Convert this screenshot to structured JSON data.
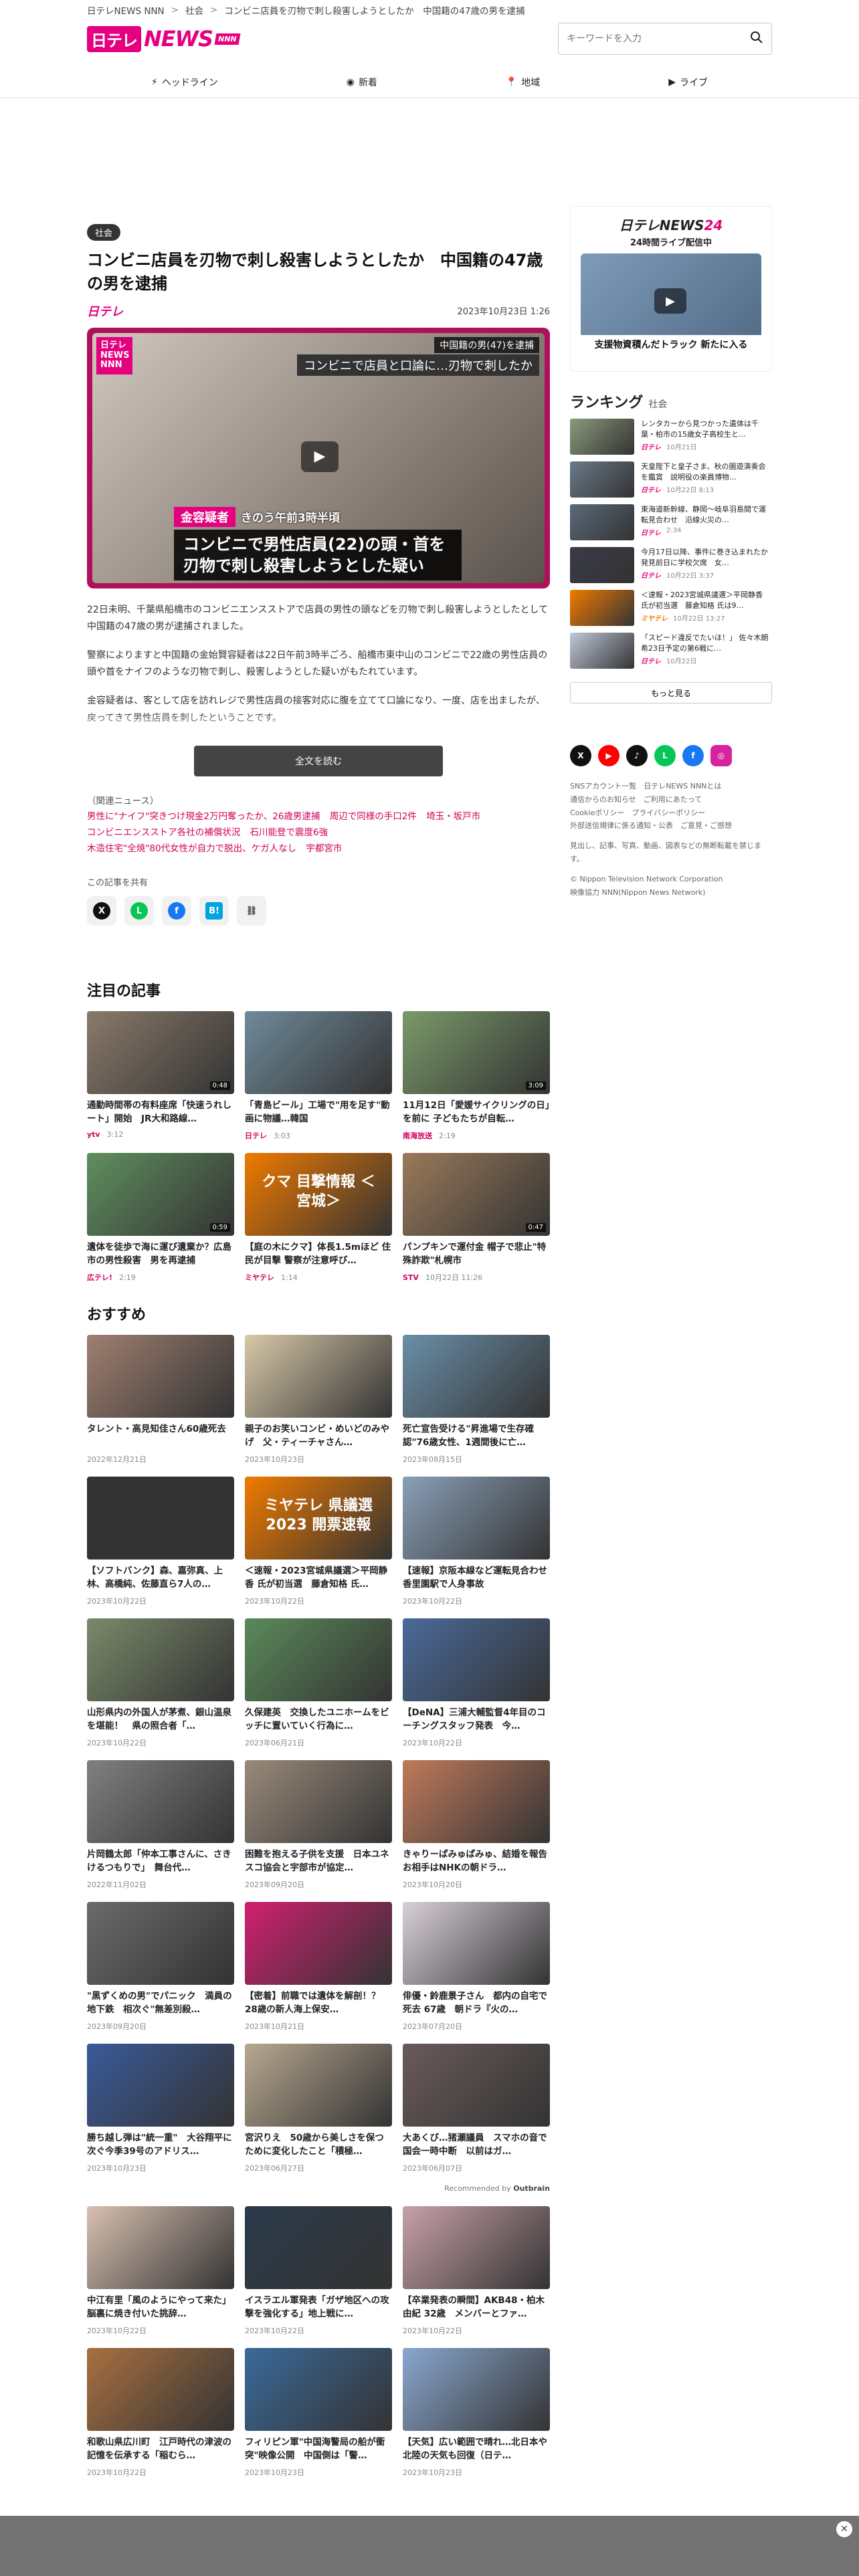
{
  "breadcrumb": [
    "日テレNEWS NNN",
    "社会",
    "コンビニ店員を刃物で刺し殺害しようとしたか　中国籍の47歳の男を逮捕"
  ],
  "brand": {
    "mark": "日テレ",
    "news": "NEWS",
    "nnn": "NNN",
    "small": "日テレ"
  },
  "search": {
    "placeholder": "キーワードを入力"
  },
  "nav": [
    {
      "label": "ヘッドライン",
      "icon": "lightning-icon"
    },
    {
      "label": "新着",
      "icon": "new-icon"
    },
    {
      "label": "地域",
      "icon": "map-pin-icon"
    },
    {
      "label": "ライブ",
      "icon": "live-icon"
    }
  ],
  "article": {
    "category": "社会",
    "title": "コンビニ店員を刃物で刺し殺害しようとしたか　中国籍の47歳の男を逮捕",
    "date": "2023年10月23日 1:26",
    "video": {
      "logo": "日テレ NEWS NNN",
      "cap_top1": "中国籍の男(47)を逮捕",
      "cap_top2": "コンビニで店員と口論に…刃物で刺したか",
      "suspect_badge": "金容疑者",
      "suspect_time": "きのう午前3時半頃",
      "cap_bottom": "コンビニで男性店員(22)の頭・首を刃物で刺し殺害しようとした疑い"
    },
    "paragraphs": [
      "22日未明、千葉県船橋市のコンビニエンスストアで店員の男性の頭などを刃物で刺し殺害しようとしたとして中国籍の47歳の男が逮捕されました。",
      "警察によりますと中国籍の金始賢容疑者は22日午前3時半ごろ、船橋市東中山のコンビニで22歳の男性店員の頭や首をナイフのような刃物で刺し、殺害しようとした疑いがもたれています。",
      "金容疑者は、客として店を訪れレジで男性店員の接客対応に腹を立てて口論になり、一度、店を出ましたが、戻ってきて男性店員を刺したということです。"
    ],
    "readmore": "全文を読む",
    "related_label": "（関連ニュース）",
    "related": [
      "男性に\"ナイフ\"突きつけ現金2万円奪ったか、26歳男逮捕",
      "周辺で同様の手口2件",
      "埼玉・坂戸市",
      "コンビニエンスストア各社の補償状況",
      "石川能登で震度6強",
      "木造住宅\"全焼\"80代女性が自力で脱出、ケガ人なし",
      "宇都宮市"
    ],
    "share_label": "この記事を共有"
  },
  "attention": {
    "title": "注目の記事",
    "items": [
      {
        "title": "通勤時間帯の有料座席「快速うれしート」開始　JR大和路線…",
        "source": "ytv",
        "time": "3:12",
        "dur": "0:48",
        "color": "#8a7a6a"
      },
      {
        "title": "「青島ビール」工場で\"用を足す\"動画に物議…韓国",
        "source": "日テレ",
        "time": "3:03",
        "dur": "",
        "color": "#6f8a9a"
      },
      {
        "title": "11月12日「愛媛サイクリングの日」を前に 子どもたちが自転…",
        "source": "南海放送",
        "time": "2:19",
        "dur": "3:09",
        "color": "#7a9a6a"
      },
      {
        "title": "遺体を徒歩で海に運び遺棄か？広島市の男性殺害　男を再逮捕",
        "source": "広テレ!",
        "time": "2:19",
        "dur": "0:59",
        "color": "#5f8f5f"
      },
      {
        "title": "【庭の木にクマ】体長1.5mほど 住民が目撃 警察が注意呼び…",
        "source": "ミヤテレ",
        "time": "1:14",
        "dur": "",
        "color": "#f07a00"
      },
      {
        "title": "パンプキンで運付金 帽子で悲止\"特殊詐欺\"札幌市",
        "source": "STV",
        "time": "10月22日 11:26",
        "dur": "0:47",
        "color": "#9a7a5a"
      }
    ],
    "kuma": "クマ 目撃情報 ＜宮城＞"
  },
  "recommend": {
    "title": "おすすめ",
    "items": [
      {
        "title": "タレント・高見知佳さん60歳死去",
        "date": "2022年12月21日",
        "color": "#a08070"
      },
      {
        "title": "親子のお笑いコンビ・めいどのみやげ　父・ティーチャさん…",
        "date": "2023年10月23日",
        "color": "#d8c8a8"
      },
      {
        "title": "死亡宣告受ける\"昇進場で生存確認\"76歳女性、1週間後に亡…",
        "date": "2023年08月15日",
        "color": "#6a8fa8"
      },
      {
        "title": "【ソフトバンク】森、嘉弥真、上林、高橋純、佐藤直ら7人の…",
        "date": "2023年10月22日",
        "color": "#333333"
      },
      {
        "title": "＜速報・2023宮城県議選＞平岡静香 氏が初当選　藤倉知格 氏…",
        "date": "2023年10月22日",
        "color": "#f07a00"
      },
      {
        "title": "【速報】京阪本線など運転見合わせ　香里園駅で人身事故",
        "date": "2023年10月22日",
        "color": "#8aa0b8"
      },
      {
        "title": "山形県内の外国人が茅煮、銀山温泉を堪能！　県の照合者「…",
        "date": "2023年10月22日",
        "color": "#7a8a6a"
      },
      {
        "title": "久保建英　交換したユニホームをビッチに置いていく行為に…",
        "date": "2023年06月21日",
        "color": "#5a8a5a"
      },
      {
        "title": "【DeNA】三浦大輔監督4年目のコーチングスタッフ発表　今…",
        "date": "2023年10月22日",
        "color": "#4a6a9a"
      },
      {
        "title": "片岡鶴太郎「仲本工事さんに、さきけるつもりで」　舞台代…",
        "date": "2022年11月02日",
        "color": "#808080"
      },
      {
        "title": "困難を抱える子供を支援　日本ユネスコ協会と宇部市が協定…",
        "date": "2023年09月20日",
        "color": "#9a8a7a"
      },
      {
        "title": "きゃりーぱみゅぱみゅ、結婚を報告　お相手はNHKの朝ドラ…",
        "date": "2023年10月20日",
        "color": "#c07a5a"
      },
      {
        "title": "\"黒ずくめの男\"でパニック　満員の地下鉄　相次ぐ\"無差別殺…",
        "date": "2023年09月20日",
        "color": "#6a6a6a"
      },
      {
        "title": "【密着】前職では遺体を解剖！？　28歳の新人海上保安…",
        "date": "2023年10月21日",
        "color": "#d02070"
      },
      {
        "title": "俳優・鈴鹿景子さん　都内の自宅で死去 67歳　朝ドラ『火の…",
        "date": "2023年07月20日",
        "color": "#d8d0d8"
      },
      {
        "title": "勝ち越し弾は\"統一重\"　大谷翔平に次ぐ今季39号のアドリス…",
        "date": "2023年10月23日",
        "color": "#3a5a9a"
      },
      {
        "title": "宮沢りえ　50歳から美しさを保つために変化したこと「積極…",
        "date": "2023年06月27日",
        "color": "#b8a890"
      },
      {
        "title": "大あくび…猪瀬議員　スマホの音で国会一時中断　以前はガ…",
        "date": "2023年06月07日",
        "color": "#6a5a5a"
      },
      {
        "title": "中江有里「風のようにやって来た」 脳裏に焼き付いた挑辞…",
        "date": "2023年10月22日",
        "color": "#d8c0b0"
      },
      {
        "title": "イスラエル軍発表「ガザ地区への攻撃を強化する」地上戦に…",
        "date": "2023年10月22日",
        "color": "#2a3a4a"
      },
      {
        "title": "【卒業発表の瞬間】AKB48・柏木由紀 32歳　メンバーとファ…",
        "date": "2023年10月22日",
        "color": "#c8a0a8"
      },
      {
        "title": "和歌山県広川町　江戸時代の津波の記憶を伝承する「稲むら…",
        "date": "2023年10月22日",
        "color": "#a87040"
      },
      {
        "title": "フィリピン軍\"中国海警局の船が衝突\"映像公開　中国側は「警…",
        "date": "2023年10月23日",
        "color": "#3a6a9a"
      },
      {
        "title": "【天気】広い範囲で晴れ…北日本や北陸の天気も回復（日テ…",
        "date": "2023年10月23日",
        "color": "#8aa8d0"
      }
    ],
    "kaihyo": "ミヤテレ 県議選2023 開票速報",
    "recommended_by": "Recommended by",
    "outbrain": "Outbrain"
  },
  "sidebar": {
    "live_brand": "日テレNEWS",
    "live_num": "24",
    "live_sub": "24時間ライブ配信中",
    "live_caption": "支援物資積んだトラック 新たに入る",
    "ranking_title": "ランキング",
    "ranking_cat": "社会",
    "ranking": [
      {
        "text": "レンタカーから見つかった遺体は千葉・柏市の15歳女子高校生と…",
        "src": "日テレ",
        "date": "10月21日",
        "color": "#8a9a7a"
      },
      {
        "text": "天皇陛下と皇子さま、秋の園遊演奏会を鑑賞　説明役の楽員博物…",
        "src": "日テレ",
        "date": "10月22日 8:13",
        "color": "#6a7a8a"
      },
      {
        "text": "東海道新幹線、静岡〜岐阜羽島間で運転見合わせ　沿線火災の…",
        "src": "日テレ",
        "date": "2:34",
        "color": "#5a6a7a"
      },
      {
        "text": "今月17日以降、事件に巻き込まれたか　発見前日に学校欠席　女…",
        "src": "日テレ",
        "date": "10月22日 3:37",
        "color": "#3a3a4a"
      },
      {
        "text": "＜速報・2023宮城県議選＞平岡静香 氏が初当選　藤倉知格 氏は9…",
        "src": "ミヤテレ",
        "date": "10月22日 13:27",
        "color": "#f07a00"
      },
      {
        "text": "「スピード違反でたいほ！」 佐々木朗希23日予定の第6戦に…",
        "src": "日テレ",
        "date": "10月22日",
        "color": "#c0c8d8"
      }
    ],
    "more": "もっと見る",
    "footer": [
      "SNSアカウント一覧　日テレNEWS NNNとは",
      "通信からのお知らせ　ご利用にあたって",
      "Cookieポリシー　プライバシーポリシー",
      "外部送信規律に係る通知・公表　ご意見・ご感想"
    ],
    "footer2": "見出し、記事、写真、動画、図表などの無断転載を禁じます。",
    "copyright": "© Nippon Television Network Corporation",
    "copyright2": "映像協力 NNN(Nippon News Network)"
  }
}
